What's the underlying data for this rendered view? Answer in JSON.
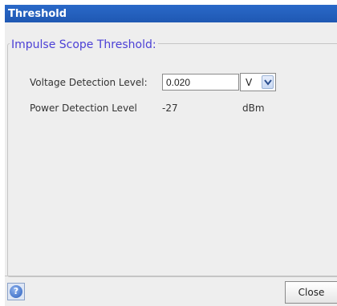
{
  "window": {
    "title": "Threshold",
    "group_title": "Impulse Scope Threshold:",
    "fields": {
      "voltage": {
        "label": "Voltage Detection Level:",
        "value": "0.020",
        "unit": "V"
      },
      "power": {
        "label": "Power Detection Level",
        "value": "-27",
        "unit": "dBm"
      }
    },
    "buttons": {
      "help_icon": "?",
      "close": "Close"
    }
  },
  "colors": {
    "titlebar": "#1f58b3",
    "group_title": "#4c40d6",
    "background": "#eeeeee"
  },
  "icons": {
    "help": "help-icon",
    "dropdown": "chevron-down-icon"
  }
}
